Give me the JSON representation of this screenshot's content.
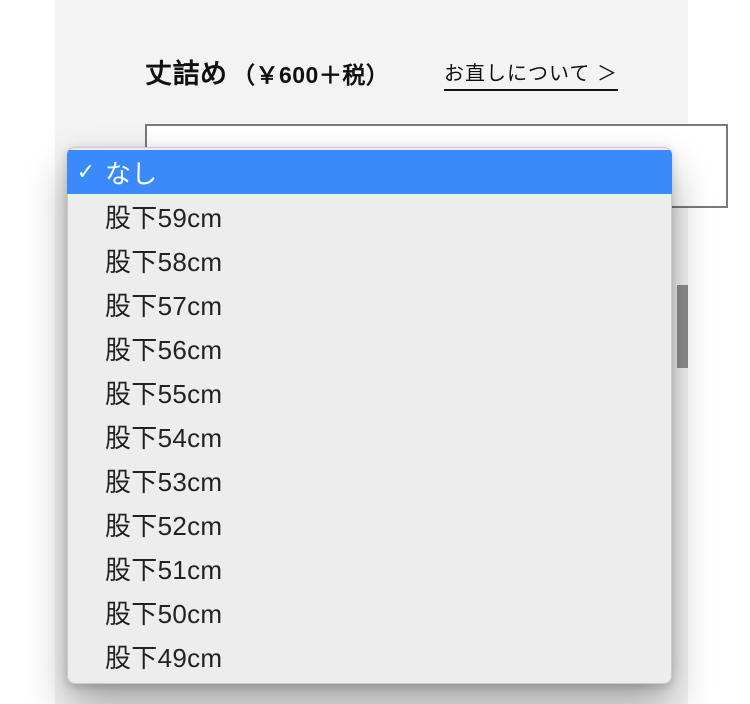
{
  "header": {
    "title_main": "丈詰め",
    "title_sub": "（￥600＋税）",
    "about_link": "お直しについて ＞"
  },
  "dropdown": {
    "selected_index": 0,
    "options": [
      "なし",
      "股下59cm",
      "股下58cm",
      "股下57cm",
      "股下56cm",
      "股下55cm",
      "股下54cm",
      "股下53cm",
      "股下52cm",
      "股下51cm",
      "股下50cm",
      "股下49cm"
    ]
  }
}
